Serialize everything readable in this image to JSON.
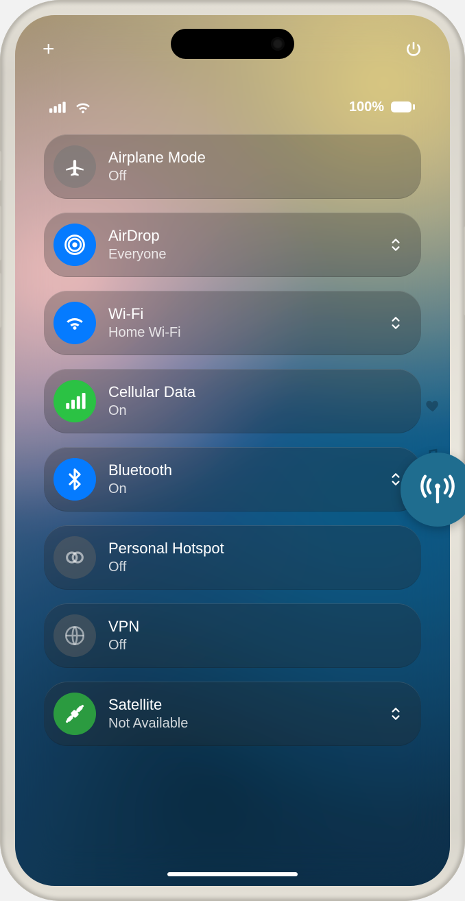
{
  "statusbar": {
    "battery_text": "100%"
  },
  "top": {
    "add": "+",
    "power": "power"
  },
  "side": {
    "favorites": "favorites-icon",
    "music": "music-icon",
    "connectivity": "connectivity-icon"
  },
  "rows": [
    {
      "id": "airplane",
      "title": "Airplane Mode",
      "subtitle": "Off",
      "icon": "airplane-icon",
      "color": "bg-grey",
      "expandable": false
    },
    {
      "id": "airdrop",
      "title": "AirDrop",
      "subtitle": "Everyone",
      "icon": "airdrop-icon",
      "color": "bg-blue",
      "expandable": true
    },
    {
      "id": "wifi",
      "title": "Wi-Fi",
      "subtitle": "Home Wi-Fi",
      "icon": "wifi-icon",
      "color": "bg-blue",
      "expandable": true
    },
    {
      "id": "cellular",
      "title": "Cellular Data",
      "subtitle": "On",
      "icon": "cellular-icon",
      "color": "bg-green",
      "expandable": false
    },
    {
      "id": "bluetooth",
      "title": "Bluetooth",
      "subtitle": "On",
      "icon": "bluetooth-icon",
      "color": "bg-blue",
      "expandable": true
    },
    {
      "id": "hotspot",
      "title": "Personal Hotspot",
      "subtitle": "Off",
      "icon": "hotspot-icon",
      "color": "bg-grey2",
      "expandable": false
    },
    {
      "id": "vpn",
      "title": "VPN",
      "subtitle": "Off",
      "icon": "vpn-icon",
      "color": "bg-grey2",
      "expandable": false
    },
    {
      "id": "satellite",
      "title": "Satellite",
      "subtitle": "Not Available",
      "icon": "satellite-icon",
      "color": "bg-green2",
      "expandable": true
    }
  ],
  "floating": {
    "name": "connectivity-page-indicator"
  }
}
